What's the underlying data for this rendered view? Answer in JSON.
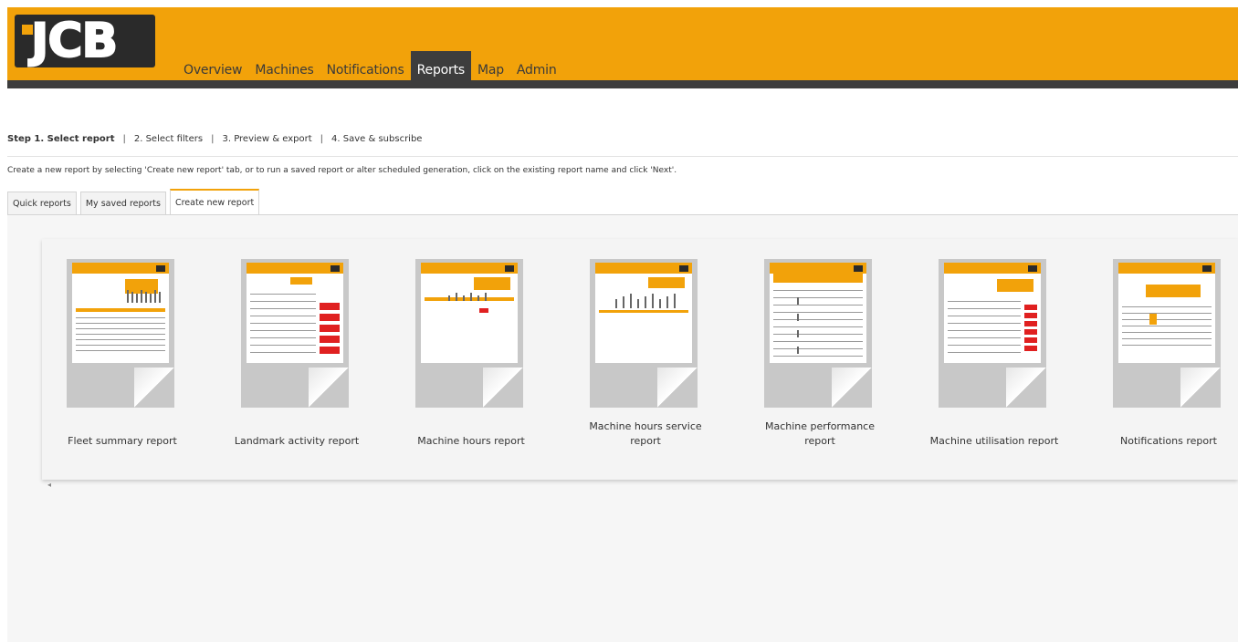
{
  "brand": {
    "logo_text": "JCB",
    "accent": "#f2a20a",
    "dark": "#3d3d3d"
  },
  "nav": {
    "items": [
      "Overview",
      "Machines",
      "Notifications",
      "Reports",
      "Map",
      "Admin"
    ],
    "active": "Reports"
  },
  "steps": {
    "items": [
      "Step 1. Select report",
      "2. Select filters",
      "3. Preview & export",
      "4. Save & subscribe"
    ],
    "current": 0
  },
  "instruction": "Create a new report by selecting 'Create new report' tab, or to run a saved report or alter scheduled generation, click on the existing report name and click 'Next'.",
  "tabs": {
    "items": [
      "Quick reports",
      "My saved reports",
      "Create new report"
    ],
    "active": "Create new report"
  },
  "reports": [
    {
      "label": "Fleet summary report",
      "icon": "report-thumbnail-icon"
    },
    {
      "label": "Landmark activity report",
      "icon": "report-thumbnail-icon"
    },
    {
      "label": "Machine hours report",
      "icon": "report-thumbnail-icon"
    },
    {
      "label": "Machine hours service report",
      "line1": "Machine hours service",
      "line2": "report",
      "icon": "report-thumbnail-icon"
    },
    {
      "label": "Machine performance report",
      "line1": "Machine performance",
      "line2": "report",
      "icon": "report-thumbnail-icon"
    },
    {
      "label": "Machine utilisation report",
      "icon": "report-thumbnail-icon"
    },
    {
      "label": "Notifications report",
      "icon": "report-thumbnail-icon"
    }
  ],
  "scroll_left_glyph": "◂"
}
